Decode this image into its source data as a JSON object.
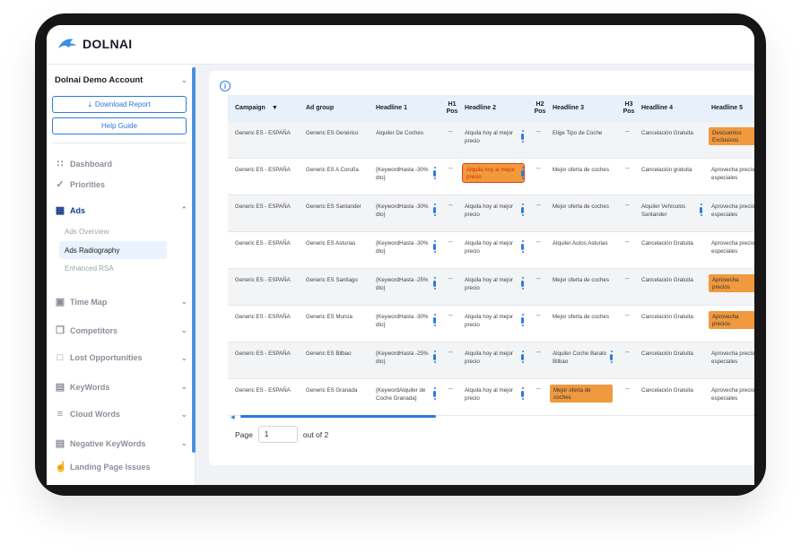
{
  "app": {
    "logo_text": "DOLNAI"
  },
  "sidebar": {
    "account": "Dolnai Demo Account",
    "download_label": "Download Report",
    "help_label": "Help Guide",
    "nav": [
      {
        "label": "Dashboard",
        "icon": "dashboard-icon"
      },
      {
        "label": "Priorities",
        "icon": "priorities-icon"
      },
      {
        "label": "Ads",
        "icon": "grid-icon"
      },
      {
        "label": "Time Map",
        "icon": "calendar-icon"
      },
      {
        "label": "Competitors",
        "icon": "copy-icon"
      },
      {
        "label": "Lost Opportunities",
        "icon": "folder-icon"
      },
      {
        "label": "KeyWords",
        "icon": "table-icon"
      },
      {
        "label": "Cloud Words",
        "icon": "filter-lines-icon"
      },
      {
        "label": "Negative KeyWords",
        "icon": "list-icon"
      },
      {
        "label": "Landing Page Issues",
        "icon": "hand-icon"
      }
    ],
    "ads_sub": [
      "Ads Overview",
      "Ads Radiography",
      "Enhanced RSA"
    ]
  },
  "table": {
    "headers": [
      "Campaign",
      "Ad group",
      "Headline 1",
      "H1 Pos",
      "Headline 2",
      "H2 Pos",
      "Headline 3",
      "H3 Pos",
      "Headline 4",
      "Headline 5"
    ],
    "rows": [
      {
        "campaign": "Generic ES - ESPAÑA",
        "adgroup": "Generic ES Genérico",
        "h1": "Alquiler De Coches",
        "h1pos": "--",
        "h2": "Alquila hoy al mejor precio",
        "h2pos": "--",
        "h3": "Elige Tipo de Coche",
        "h3pos": "--",
        "h4": "Cancelación Gratuita",
        "h5": "Descuentos Exclusivos"
      },
      {
        "campaign": "Generic ES - ESPAÑA",
        "adgroup": "Generic ES A Coruña",
        "h1": "{KeywordHasta -30% dto}",
        "h1pos": "--",
        "h2": "Alquila hoy al mejor precio",
        "h2pos": "--",
        "h3": "Mejor oferta de coches",
        "h3pos": "--",
        "h4": "Cancelación gratuita",
        "h5": "Aprovecha precios especiales"
      },
      {
        "campaign": "Generic ES - ESPAÑA",
        "adgroup": "Generic ES Santander",
        "h1": "{KeywordHasta -30% dto}",
        "h1pos": "--",
        "h2": "Alquila hoy al mejor precio",
        "h2pos": "--",
        "h3": "Mejor oferta de coches",
        "h3pos": "--",
        "h4": "Alquiler Vehículos Santander",
        "h5": "Aprovecha precios especiales"
      },
      {
        "campaign": "Generic ES - ESPAÑA",
        "adgroup": "Generic ES Asturias",
        "h1": "{KeywordHasta -30% dto}",
        "h1pos": "--",
        "h2": "Alquila hoy al mejor precio",
        "h2pos": "--",
        "h3": "Alquiler Autos Asturias",
        "h3pos": "--",
        "h4": "Cancelación Gratuita",
        "h5": "Aprovecha precios especiales"
      },
      {
        "campaign": "Generic ES - ESPAÑA",
        "adgroup": "Generic ES Santiago",
        "h1": "{KeywordHasta -25% dto}",
        "h1pos": "--",
        "h2": "Alquila hoy al mejor precio",
        "h2pos": "--",
        "h3": "Mejor oferta de coches",
        "h3pos": "--",
        "h4": "Cancelación Gratuita",
        "h5": "Aprovecha precios especiales"
      },
      {
        "campaign": "Generic ES - ESPAÑA",
        "adgroup": "Generic ES Murcia",
        "h1": "{KeywordHasta -30% dto}",
        "h1pos": "--",
        "h2": "Alquila hoy al mejor precio",
        "h2pos": "--",
        "h3": "Mejor oferta de coches",
        "h3pos": "--",
        "h4": "Cancelación Gratuita",
        "h5": "Aprovecha precios especiales"
      },
      {
        "campaign": "Generic ES - ESPAÑA",
        "adgroup": "Generic ES Bilbao",
        "h1": "{KeywordHasta -25% dto}",
        "h1pos": "--",
        "h2": "Alquila hoy al mejor precio",
        "h2pos": "--",
        "h3": "Alquiler Coche Barato Bilbao",
        "h3pos": "--",
        "h4": "Cancelación Gratuita",
        "h5": "Aprovecha precios especiales"
      },
      {
        "campaign": "Generic ES - ESPAÑA",
        "adgroup": "Generic ES Granada",
        "h1": "{KeywordAlquiler de Coche Granada}",
        "h1pos": "--",
        "h2": "Alquila hoy al mejor precio",
        "h2pos": "--",
        "h3": "Mejor oferta de coches",
        "h3pos": "--",
        "h4": "Cancelación Gratuita",
        "h5": "Aprovecha precios especiales"
      }
    ]
  },
  "pager": {
    "label": "Page",
    "value": "1",
    "out_of": "out of 2"
  },
  "colors": {
    "accent": "#2d7ae0",
    "highlight": "#f0993e",
    "error": "#e3401c"
  }
}
